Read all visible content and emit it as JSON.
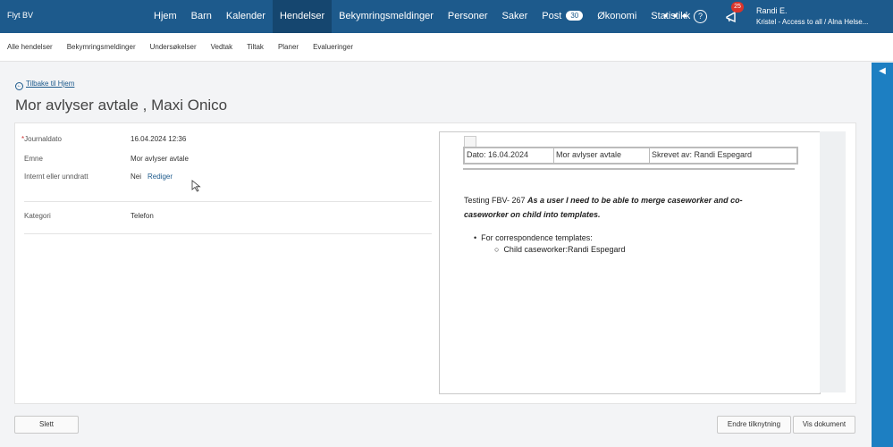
{
  "app": {
    "brand": "Flyt BV"
  },
  "nav": {
    "items": [
      "Hjem",
      "Barn",
      "Kalender",
      "Hendelser",
      "Bekymringsmeldinger",
      "Personer",
      "Saker",
      "Post",
      "Økonomi",
      "Statistikk"
    ],
    "active": "Hendelser",
    "post_count": "30",
    "more": "• • •",
    "help": "?",
    "notifications": "25"
  },
  "user": {
    "name": "Randi E.",
    "org": "Kristel - Access to all / Alna Helse..."
  },
  "subnav": {
    "items": [
      "Alle hendelser",
      "Bekymringsmeldinger",
      "Undersøkelser",
      "Vedtak",
      "Tiltak",
      "Planer",
      "Evalueringer"
    ]
  },
  "back_link": "Tilbake til Hjem",
  "title": "Mor avlyser avtale , Maxi Onico",
  "fields": {
    "journaldato_label": "Journaldato",
    "journaldato_required": "*",
    "journaldato": "16.04.2024 12:36",
    "emne_label": "Emne",
    "emne": "Mor avlyser avtale",
    "internt_label": "Internt eller unndratt",
    "internt": "Nei",
    "rediger": "Rediger",
    "kategori_label": "Kategori",
    "kategori": "Telefon"
  },
  "document": {
    "header_cells": [
      "Dato: 16.04.2024",
      "Mor avlyser avtale",
      "Skrevet av: Randi Espegard"
    ],
    "text_prefix": "Testing FBV- 267 ",
    "text_bold": "As a user I need to be able to merge caseworker and co-caseworker on child into templates.",
    "list_item": "For correspondence templates:",
    "sub_item": "Child caseworker:Randi Espegard"
  },
  "buttons": {
    "delete": "Slett",
    "change_link": "Endre tilknytning",
    "show_doc": "Vis dokument"
  },
  "colors": {
    "nav_bg": "#1d5a8c",
    "nav_active": "#15466f",
    "accent": "#1d7fc2",
    "badge": "#d9342b"
  },
  "icons": {
    "back": "arrow-left-circle-icon",
    "help": "question-circle-icon",
    "notify": "megaphone-icon",
    "sidebar": "arrow-left-icon"
  }
}
